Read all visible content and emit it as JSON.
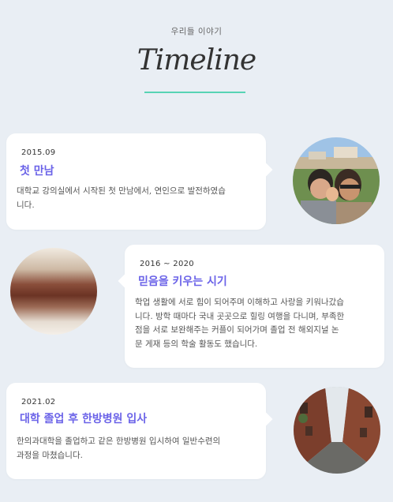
{
  "header": {
    "subtitle": "우리들 이야기",
    "title": "Timeline",
    "accent_color": "#58d3b4"
  },
  "events": [
    {
      "date": "2015.09",
      "title": "첫 만남",
      "desc_lines": [
        "대학교 강의실에서 시작된 첫 만남에서, 연인으로 발전하였습",
        "니다."
      ],
      "photo": "couple-selfie-photo"
    },
    {
      "date": "2016 ~ 2020",
      "title": "믿음을 키우는 시기",
      "desc_lines": [
        "학업 생활에 서로 힘이 되어주며 이해하고 사랑을 키워나갔습",
        "니다. 방학 때마다 국내 곳곳으로 힐링 여행을 다니며, 부족한",
        "점을 서로 보완해주는 커플이 되어가며 졸업 전 해외지널 논",
        "문 게재 등의 학술 활동도 했습니다."
      ],
      "photo": "blurred-closeup-photo"
    },
    {
      "date": "2021.02",
      "title": "대학 졸업 후 한방병원 입사",
      "desc_lines": [
        "한의과대학을 졸업하고 같은 한방병원 입시하여 일반수련의",
        "과정을 마쳤습니다."
      ],
      "photo": "alley-street-photo"
    }
  ],
  "colors": {
    "background": "#e9eef4",
    "event_title": "#6b63e8"
  }
}
